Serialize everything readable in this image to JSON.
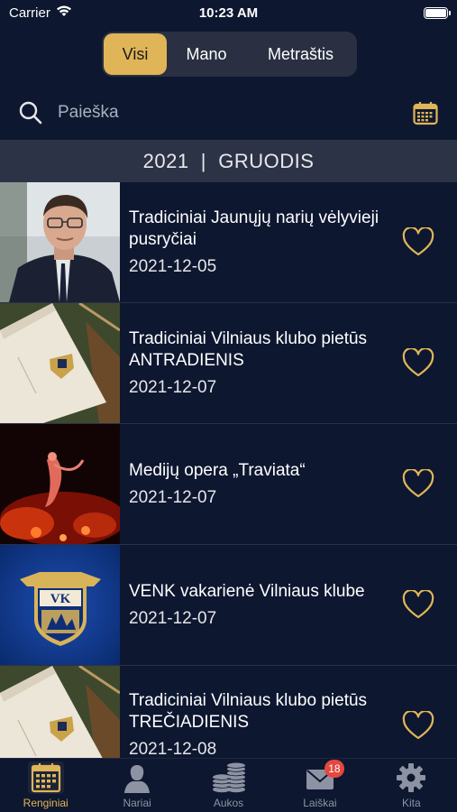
{
  "status_bar": {
    "carrier": "Carrier",
    "time": "10:23 AM"
  },
  "segments": {
    "items": [
      "Visi",
      "Mano",
      "Metraštis"
    ],
    "selected": "Visi"
  },
  "search": {
    "placeholder": "Paieška"
  },
  "section": {
    "header": "2021  |  GRUODIS"
  },
  "events": [
    {
      "title": "Tradiciniai Jaunųjų narių vėlyvieji pusryčiai",
      "date": "2021-12-05",
      "thumb_icon": "portrait-photo"
    },
    {
      "title": "Tradiciniai Vilniaus klubo pietūs ANTRADIENIS",
      "date": "2021-12-07",
      "thumb_icon": "menu-card-photo"
    },
    {
      "title": "Medijų opera „Traviata“",
      "date": "2021-12-07",
      "thumb_icon": "opera-photo"
    },
    {
      "title": "VENK vakarienė Vilniaus klube",
      "date": "2021-12-07",
      "thumb_icon": "vk-logo"
    },
    {
      "title": "Tradiciniai Vilniaus klubo pietūs TREČIADIENIS",
      "date": "2021-12-08",
      "thumb_icon": "menu-card-photo"
    }
  ],
  "tabs": {
    "renginiai": "Renginiai",
    "nariai": "Nariai",
    "aukos": "Aukos",
    "laiskai": "Laiškai",
    "kita": "Kita",
    "laiskai_badge": "18",
    "active": "Renginiai"
  },
  "colors": {
    "background": "#0d1730",
    "accent_gold": "#e0b558",
    "section_header": "#2c3346",
    "badge_red": "#e5473e",
    "tab_inactive": "#8d93a3"
  }
}
